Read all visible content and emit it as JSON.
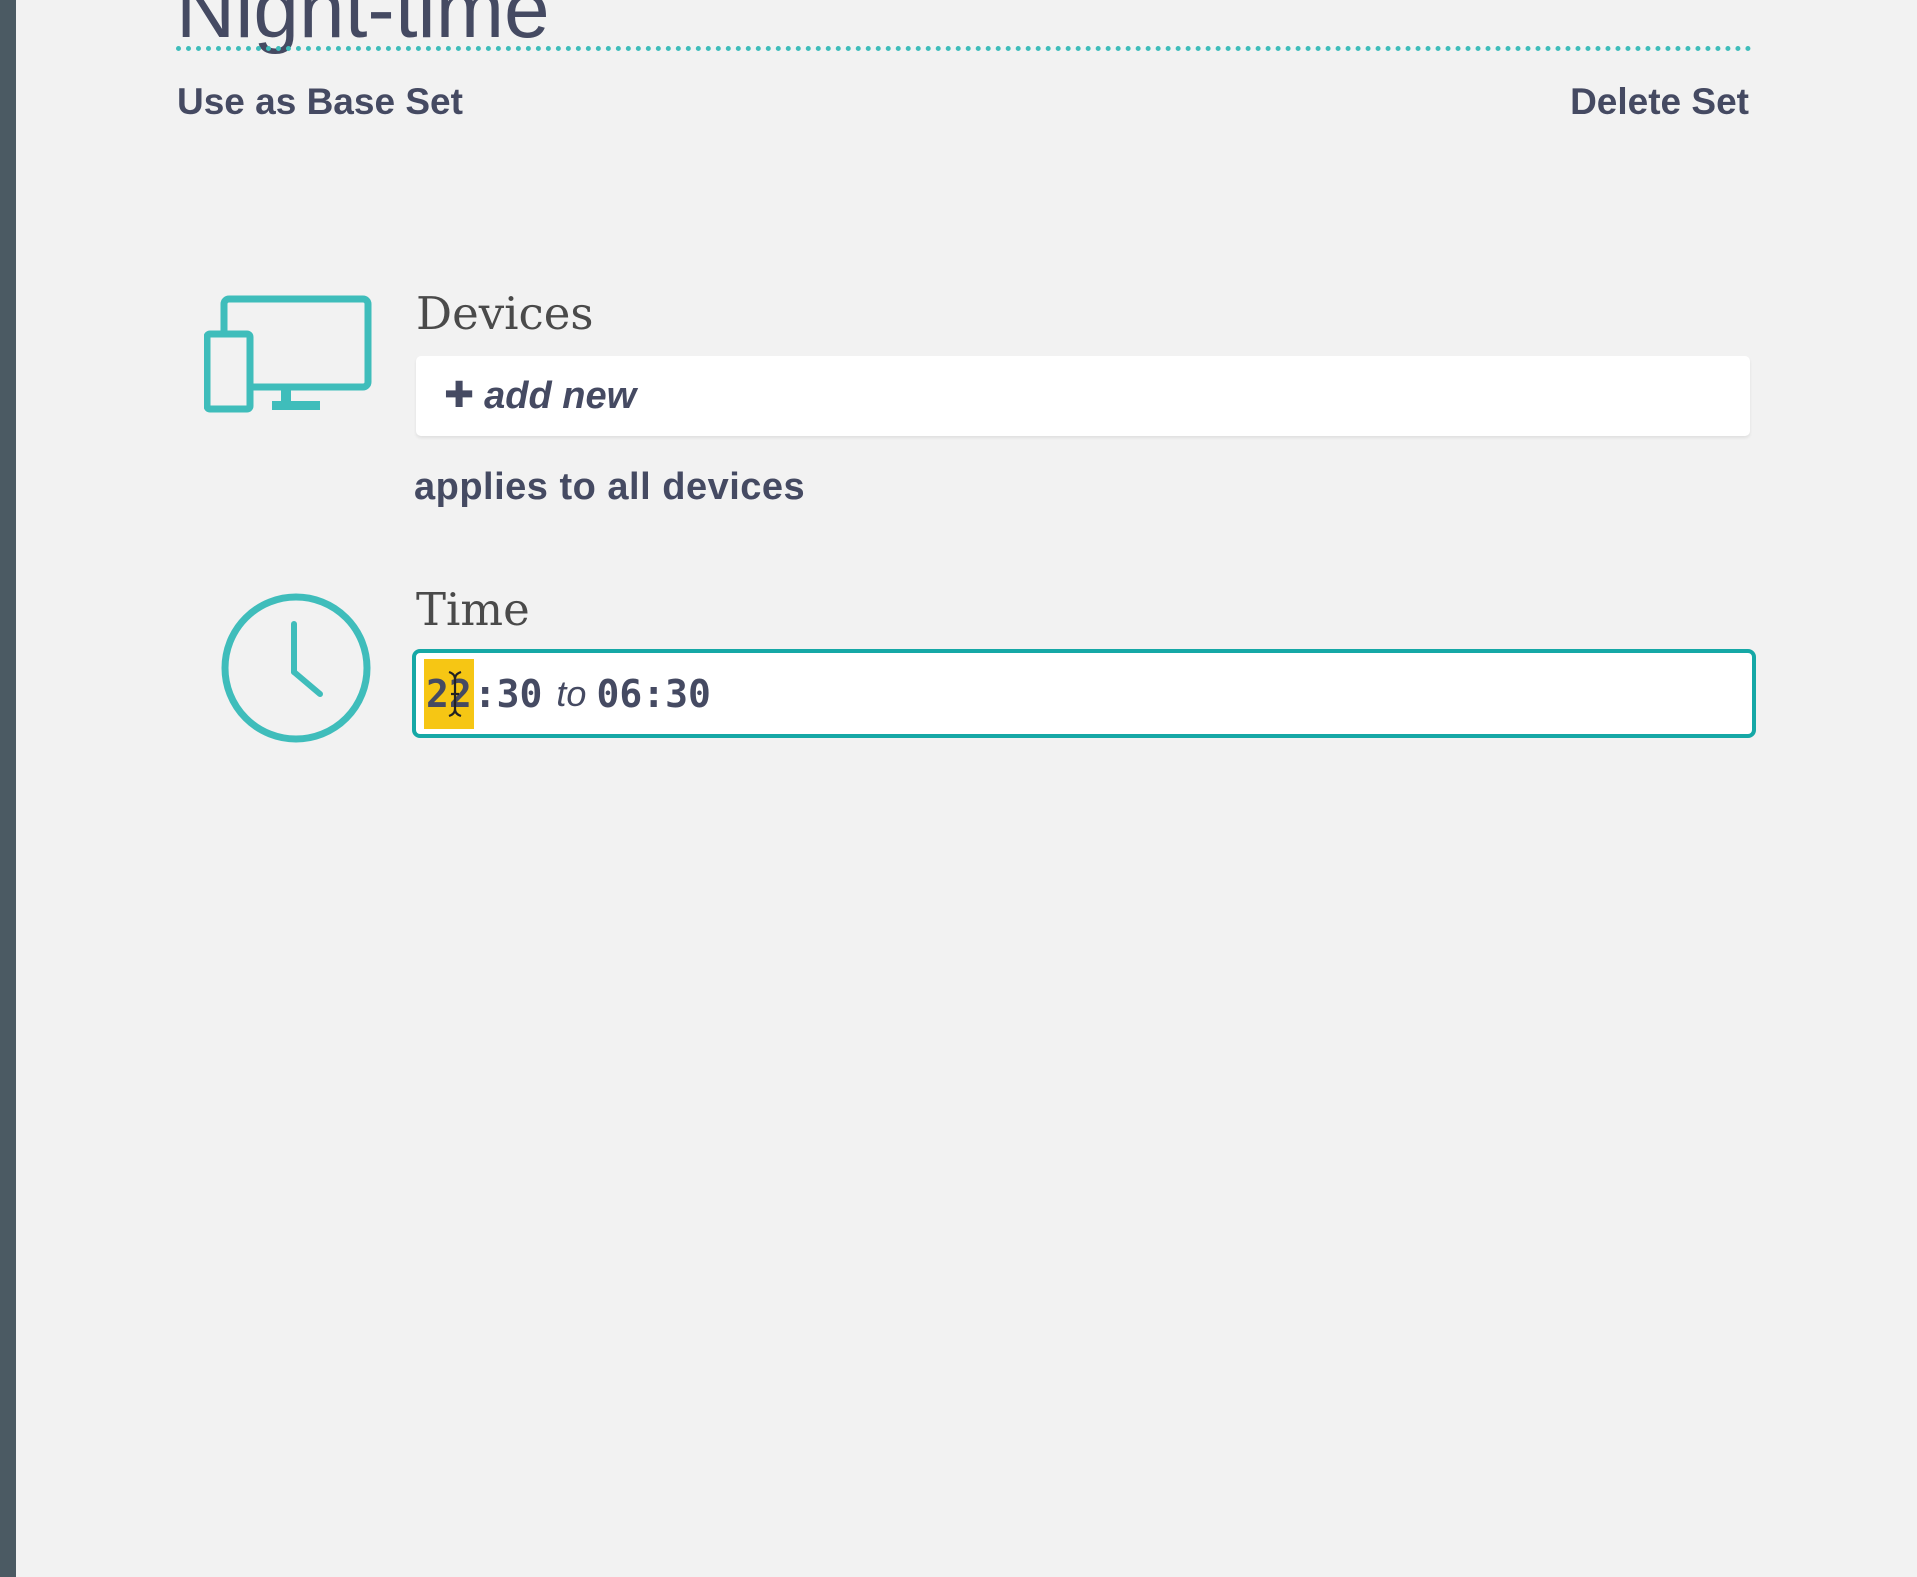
{
  "header": {
    "title": "Night-time",
    "use_as_base_label": "Use as Base Set",
    "delete_label": "Delete Set"
  },
  "devices": {
    "label": "Devices",
    "icon": "devices-icon",
    "add_new_label": "add new",
    "applies_text": "applies to all devices"
  },
  "time": {
    "label": "Time",
    "icon": "clock-icon",
    "start_hour": "22",
    "start_minute_suffix": ":30",
    "separator": "to",
    "end_time": "06:30"
  },
  "colors": {
    "accent": "#3fbdbb",
    "focus_border": "#16a8a6",
    "text": "#454a62",
    "highlight": "#f6c614",
    "background": "#f2f2f2",
    "sidebar": "#4b5a63"
  }
}
